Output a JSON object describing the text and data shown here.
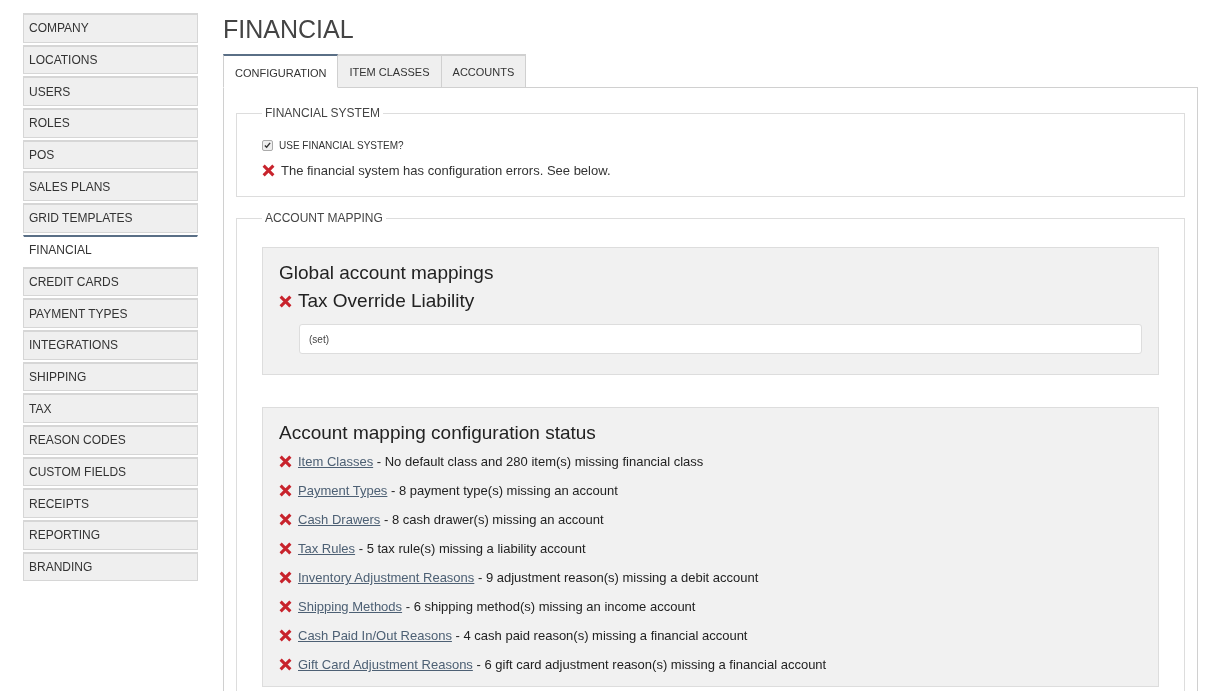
{
  "sidebar": {
    "items": [
      {
        "label": "COMPANY",
        "selected": false
      },
      {
        "label": "LOCATIONS",
        "selected": false
      },
      {
        "label": "USERS",
        "selected": false
      },
      {
        "label": "ROLES",
        "selected": false
      },
      {
        "label": "POS",
        "selected": false
      },
      {
        "label": "SALES PLANS",
        "selected": false
      },
      {
        "label": "GRID TEMPLATES",
        "selected": false
      },
      {
        "label": "FINANCIAL",
        "selected": true
      },
      {
        "label": "CREDIT CARDS",
        "selected": false
      },
      {
        "label": "PAYMENT TYPES",
        "selected": false
      },
      {
        "label": "INTEGRATIONS",
        "selected": false
      },
      {
        "label": "SHIPPING",
        "selected": false
      },
      {
        "label": "TAX",
        "selected": false
      },
      {
        "label": "REASON CODES",
        "selected": false
      },
      {
        "label": "CUSTOM FIELDS",
        "selected": false
      },
      {
        "label": "RECEIPTS",
        "selected": false
      },
      {
        "label": "REPORTING",
        "selected": false
      },
      {
        "label": "BRANDING",
        "selected": false
      }
    ]
  },
  "page_title": "FINANCIAL",
  "tabs": [
    {
      "label": "CONFIGURATION",
      "selected": true
    },
    {
      "label": "ITEM CLASSES",
      "selected": false
    },
    {
      "label": "ACCOUNTS",
      "selected": false
    }
  ],
  "financial_system": {
    "legend": "FINANCIAL SYSTEM",
    "checkbox": {
      "label": "USE FINANCIAL SYSTEM?",
      "checked": true
    },
    "message": {
      "ok": false,
      "text": "The financial system has configuration errors. See below."
    }
  },
  "account_mapping": {
    "legend": "ACCOUNT MAPPING",
    "global": {
      "title": "Global account mappings",
      "mapping": {
        "ok": false,
        "label": "Tax Override Liability",
        "value": "(set)"
      }
    },
    "status": {
      "title": "Account mapping configuration status",
      "items": [
        {
          "ok": false,
          "link": "Item Classes",
          "detail": "- No default class and 280 item(s) missing financial class"
        },
        {
          "ok": false,
          "link": "Payment Types",
          "detail": "- 8 payment type(s) missing an account"
        },
        {
          "ok": false,
          "link": "Cash Drawers",
          "detail": "- 8 cash drawer(s) missing an account"
        },
        {
          "ok": false,
          "link": "Tax Rules",
          "detail": "- 5 tax rule(s) missing a liability account"
        },
        {
          "ok": false,
          "link": "Inventory Adjustment Reasons",
          "detail": "- 9 adjustment reason(s) missing a debit account"
        },
        {
          "ok": false,
          "link": "Shipping Methods",
          "detail": "- 6 shipping method(s) missing an income account"
        },
        {
          "ok": false,
          "link": "Cash Paid In/Out Reasons",
          "detail": "- 4 cash paid reason(s) missing a financial account"
        },
        {
          "ok": false,
          "link": "Gift Card Adjustment Reasons",
          "detail": "- 6 gift card adjustment reason(s) missing a financial account"
        }
      ]
    }
  }
}
